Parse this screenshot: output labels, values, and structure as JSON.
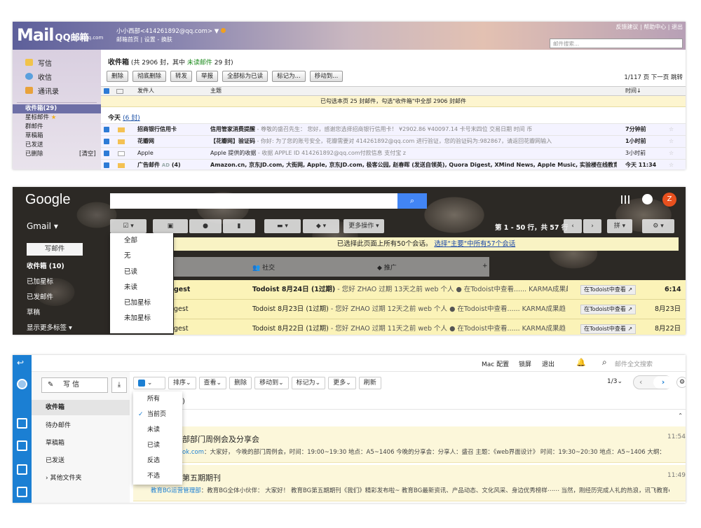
{
  "qq": {
    "logo_main": "Mail",
    "logo_cn": "QQ邮箱",
    "logo_sub": "mail.qq.com",
    "user_line": "小小西部<414261892@qq.com>",
    "user_arrow": "▼",
    "sublinks": "邮箱首页 | 设置 - 换肤",
    "toplinks": "反馈建议 | 帮助中心 | 退出",
    "search_placeholder": "邮件搜索...",
    "nav_big": [
      "写信",
      "收信",
      "通讯录"
    ],
    "nav_small": [
      "收件箱(29)",
      "星标邮件",
      "群邮件",
      "草稿箱",
      "已发送",
      "已删除"
    ],
    "clear_label": "[清空]",
    "title_prefix": "收件箱",
    "title_count": "(共 2906 封，其中",
    "title_unread": "未读邮件",
    "title_unread_count": "29 封)",
    "buttons": [
      "删除",
      "彻底删除",
      "转发",
      "举报",
      "全部标为已读",
      "标记为...",
      "移动到..."
    ],
    "pager": "1/117 页  下一页  跳转",
    "col_sender": "发件人",
    "col_subject": "主题",
    "col_time": "时间↓",
    "notice": "已勾选本页 25 封邮件，勾选\"收件箱\"中全部 2906 封邮件",
    "today_label": "今天",
    "today_count": "(6 封)",
    "rows": [
      {
        "sender": "招商银行信用卡",
        "subject": "信用管家消费提醒",
        "preview": " - 尊敬的盛召先生： 您好，感谢您选择招商银行信用卡！ ¥2902.86 ¥40097.14 卡号末四位 交易日期 时间 币",
        "time": "7分钟前"
      },
      {
        "sender": "花瓣网",
        "subject": "【花瓣网】验证码",
        "preview": " - 你好: 为了您的账号安全，花瓣需要对 414261892@qq.com 进行验证，您的验证码为:982867，请返回花瓣网输入",
        "time": "1小时前"
      },
      {
        "sender": "Apple",
        "subject": "Apple 提供的收据",
        "preview": " - 收据 APPLE ID 414261892@qq.com付款信息 支付宝 z",
        "time": "3小时前"
      },
      {
        "sender": "广告邮件",
        "subject": "Amazon.cn, 京东JD.com, 大街网, Apple, 京东JD.com, 极客公园, 赵春晖 (发送自领英), Quora Digest, XMind News, Apple Music, 实验楼在线教育, 知...",
        "preview": "",
        "time": "今天 11:34"
      }
    ],
    "ad_tag": "AD",
    "ad_count": "(4)"
  },
  "gmail": {
    "logo": "Google",
    "label": "Gmail",
    "more_actions": "更多操作",
    "count": "第 1 - 50 行，共 57 行",
    "compose": "写邮件",
    "labels": [
      "收件箱 (10)",
      "已加星标",
      "已发邮件",
      "草稿",
      "显示更多标签"
    ],
    "banner_text": "已选择此页面上所有50个会话。",
    "banner_link": "选择\"主要\"中所有57个会话",
    "tabs": [
      "社交",
      "推广"
    ],
    "menu": [
      "全部",
      "无",
      "已读",
      "未读",
      "已加星标",
      "未加星标"
    ],
    "rows": [
      {
        "sender": "gest",
        "subject": "Todoist 8月24日 (1过期)",
        "preview": " - 您好 ZHAO 过期 13天之前 web 个人 ● 在Todoist中查看...... KARMA成果趋",
        "chip": "在Todoist中查看 ↗",
        "time": "6:14"
      },
      {
        "sender": "gest",
        "subject": "Todoist 8月23日 (1过期)",
        "preview": " - 您好 ZHAO 过期 12天之前 web 个人 ● 在Todoist中查看...... KARMA成果趋",
        "chip": "在Todoist中查看 ↗",
        "time": "8月23日"
      },
      {
        "sender": "gest",
        "subject": "Todoist 8月22日 (1过期)",
        "preview": " - 您好 ZHAO 过期 11天之前 web 个人 ● 在Todoist中查看...... KARMA成果趋",
        "chip": "在Todoist中查看 ↗",
        "time": "8月22日"
      }
    ]
  },
  "newqq": {
    "top_links": [
      "Mac 配置",
      "锁屏",
      "退出"
    ],
    "search_placeholder": "邮件全文搜索",
    "compose": "写 信",
    "folders": [
      "收件箱",
      "待办邮件",
      "草稿箱",
      "已发送",
      "其他文件夹"
    ],
    "toolbar": [
      "排序⌄",
      "查看⌄",
      "删除",
      "移动到⌄",
      "标记为⌄",
      "更多⌄",
      "刷新"
    ],
    "page": "1/3⌄",
    "header_tail": ")",
    "menu": [
      "所有",
      "当前页",
      "未读",
      "已读",
      "反选",
      "不选"
    ],
    "menu_checked": "✓",
    "items": [
      {
        "title": "部部门周例会及分享会",
        "sender": "ok.com",
        "preview": "：大家好， 今晚的部门周例会，时间：19:00~19:30 地点：A5~1406 今晚的分享会：分享人：盛召 主题：《web界面设计》 时间：19:30~20:30 地点：A5~1406 大纲： 交",
        "time": "11:54"
      },
      {
        "title": "第五期期刊",
        "sender": "教育BG运营管理部",
        "preview": "：教育BG全体小伙伴： 大家好！ 教育BG第五期期刊《我们》精彩发布啦~ 教育BG最新资讯、产品动态、文化风采、身边优秀榜样⋯⋯ 当然，刚经历完成人礼的热浪，讯飞教育er们",
        "time": "11:49"
      }
    ]
  }
}
